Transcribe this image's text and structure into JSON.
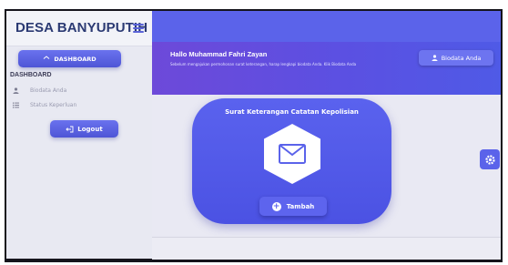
{
  "sidebar": {
    "brand": "DESA BANYUPUTIH",
    "dashboard_button": "DASHBOARD",
    "section_label": "DASHBOARD",
    "items": [
      {
        "label": "Biodata Anda",
        "icon": "user-icon"
      },
      {
        "label": "Status Keperluan",
        "icon": "list-icon"
      }
    ],
    "logout_label": "Logout"
  },
  "header": {
    "greeting": "Hallo Muhammad Fahri Zayan",
    "subtext": "Sebelum mengajukan permohonan surat keterangan, harap lengkapi biodata Anda. Klik Biodata Anda",
    "biodata_button": "Biodata Anda"
  },
  "card": {
    "title": "Surat Keterangan Catatan Kepolisian",
    "icon": "mail-icon",
    "add_button": "Tambah"
  },
  "colors": {
    "primary": "#5b63ea",
    "header_gradient_start": "#6d49d9",
    "sidebar_bg": "#e8e9f2",
    "brand_text": "#2b3a73"
  }
}
